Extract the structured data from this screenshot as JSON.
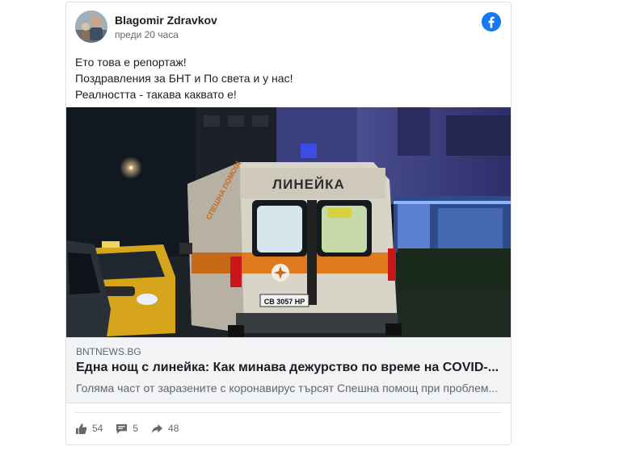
{
  "post": {
    "author": "Blagomir Zdravkov",
    "timestamp": "преди 20 часа",
    "text_lines": [
      "Ето това е репортаж!",
      "Поздравления за БНТ и По света и у нас!",
      "Реалността - такава каквато е!"
    ],
    "platform_icon": "facebook-icon"
  },
  "media": {
    "ambulance_label": "ЛИНЕЙКА",
    "side_label": "СПЕШНА ПОМОЩ",
    "plate": "CB 3057 HP"
  },
  "link": {
    "domain": "BNTNEWS.BG",
    "title": "Една нощ с линейка: Как минава дежурство по време на COVID-...",
    "description": "Голяма част от заразените с коронавирус търсят Спешна помощ при проблем..."
  },
  "actions": {
    "likes": "54",
    "comments": "5",
    "shares": "48",
    "icons": [
      "thumbs-up-icon",
      "comment-icon",
      "share-icon"
    ]
  },
  "colors": {
    "facebook_blue": "#1877f2",
    "muted_text": "#65676b",
    "link_bg": "#f2f3f5"
  }
}
